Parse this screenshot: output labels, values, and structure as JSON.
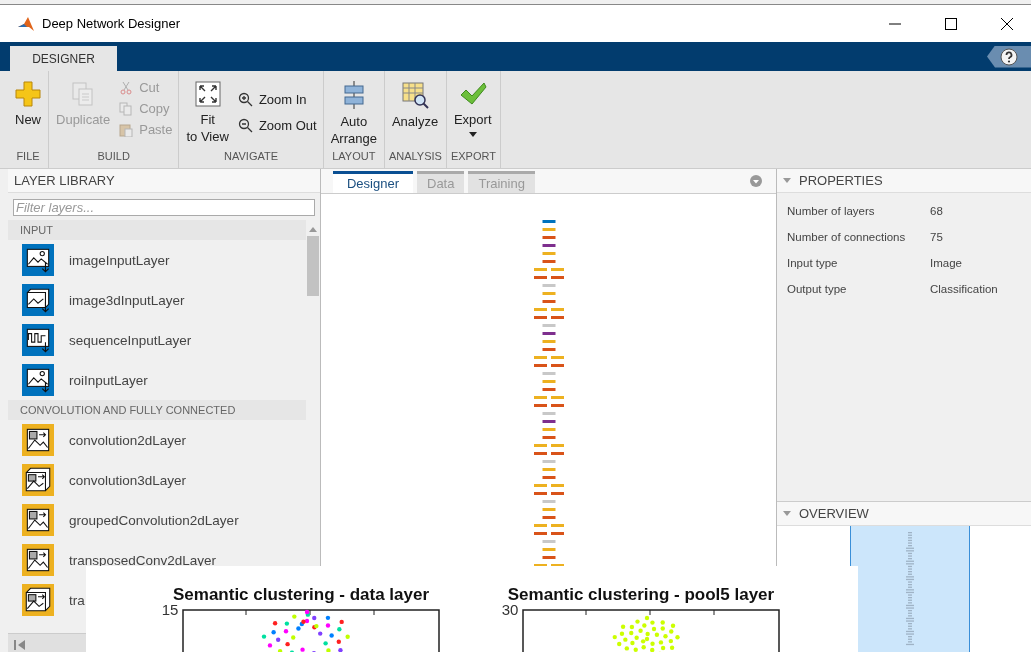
{
  "window": {
    "title": "Deep Network Designer"
  },
  "ribbon": {
    "tabs": [
      {
        "label": "DESIGNER",
        "selected": true
      }
    ],
    "groups": [
      {
        "label": "FILE",
        "buttons": [
          {
            "lines": [
              "New"
            ],
            "kind": "large",
            "disabled": false
          }
        ]
      },
      {
        "label": "BUILD",
        "buttons": [
          {
            "lines": [
              "Duplicate"
            ],
            "kind": "large",
            "disabled": true
          },
          {
            "lines": [
              "Cut"
            ],
            "kind": "small",
            "disabled": true
          },
          {
            "lines": [
              "Copy"
            ],
            "kind": "small",
            "disabled": true
          },
          {
            "lines": [
              "Paste"
            ],
            "kind": "small",
            "disabled": true
          }
        ]
      },
      {
        "label": "NAVIGATE",
        "buttons": [
          {
            "lines": [
              "Fit",
              "to View"
            ],
            "kind": "large",
            "disabled": false
          },
          {
            "lines": [
              "Zoom In"
            ],
            "kind": "small",
            "disabled": false
          },
          {
            "lines": [
              "Zoom Out"
            ],
            "kind": "small",
            "disabled": false
          }
        ]
      },
      {
        "label": "LAYOUT",
        "buttons": [
          {
            "lines": [
              "Auto",
              "Arrange"
            ],
            "kind": "large",
            "disabled": false
          }
        ]
      },
      {
        "label": "ANALYSIS",
        "buttons": [
          {
            "lines": [
              "Analyze"
            ],
            "kind": "large",
            "disabled": false
          }
        ]
      },
      {
        "label": "EXPORT",
        "buttons": [
          {
            "lines": [
              "Export"
            ],
            "kind": "large",
            "disabled": false,
            "dropdown": true
          }
        ]
      }
    ]
  },
  "layer_library": {
    "title": "LAYER LIBRARY",
    "filter": {
      "placeholder": "Filter layers..."
    },
    "sections": [
      {
        "title": "INPUT",
        "items": [
          {
            "label": "imageInputLayer",
            "color": "#0072bd"
          },
          {
            "label": "image3dInputLayer",
            "color": "#0072bd"
          },
          {
            "label": "sequenceInputLayer",
            "color": "#0072bd"
          },
          {
            "label": "roiInputLayer",
            "color": "#0072bd"
          }
        ]
      },
      {
        "title": "CONVOLUTION AND FULLY CONNECTED",
        "items": [
          {
            "label": "convolution2dLayer",
            "color": "#edb120"
          },
          {
            "label": "convolution3dLayer",
            "color": "#edb120"
          },
          {
            "label": "groupedConvolution2dLayer",
            "color": "#edb120"
          },
          {
            "label": "transposedConv2dLayer",
            "color": "#edb120"
          },
          {
            "label": "tra",
            "color": "#edb120"
          }
        ]
      }
    ]
  },
  "canvas": {
    "tabs": [
      {
        "label": "Designer",
        "selected": true
      },
      {
        "label": "Data",
        "selected": false
      },
      {
        "label": "Training",
        "selected": false
      }
    ]
  },
  "properties": {
    "title": "PROPERTIES",
    "rows": [
      {
        "name": "Number of layers",
        "value": "68"
      },
      {
        "name": "Number of connections",
        "value": "75"
      },
      {
        "name": "Input type",
        "value": "Image"
      },
      {
        "name": "Output type",
        "value": "Classification"
      }
    ]
  },
  "overview": {
    "title": "OVERVIEW"
  },
  "figure": {
    "plots": [
      {
        "title": "Semantic clustering - data layer",
        "ytick": "15",
        "kind": "spread"
      },
      {
        "title": "Semantic clustering - pool5 layer",
        "ytick": "30",
        "kind": "cluster"
      }
    ]
  }
}
